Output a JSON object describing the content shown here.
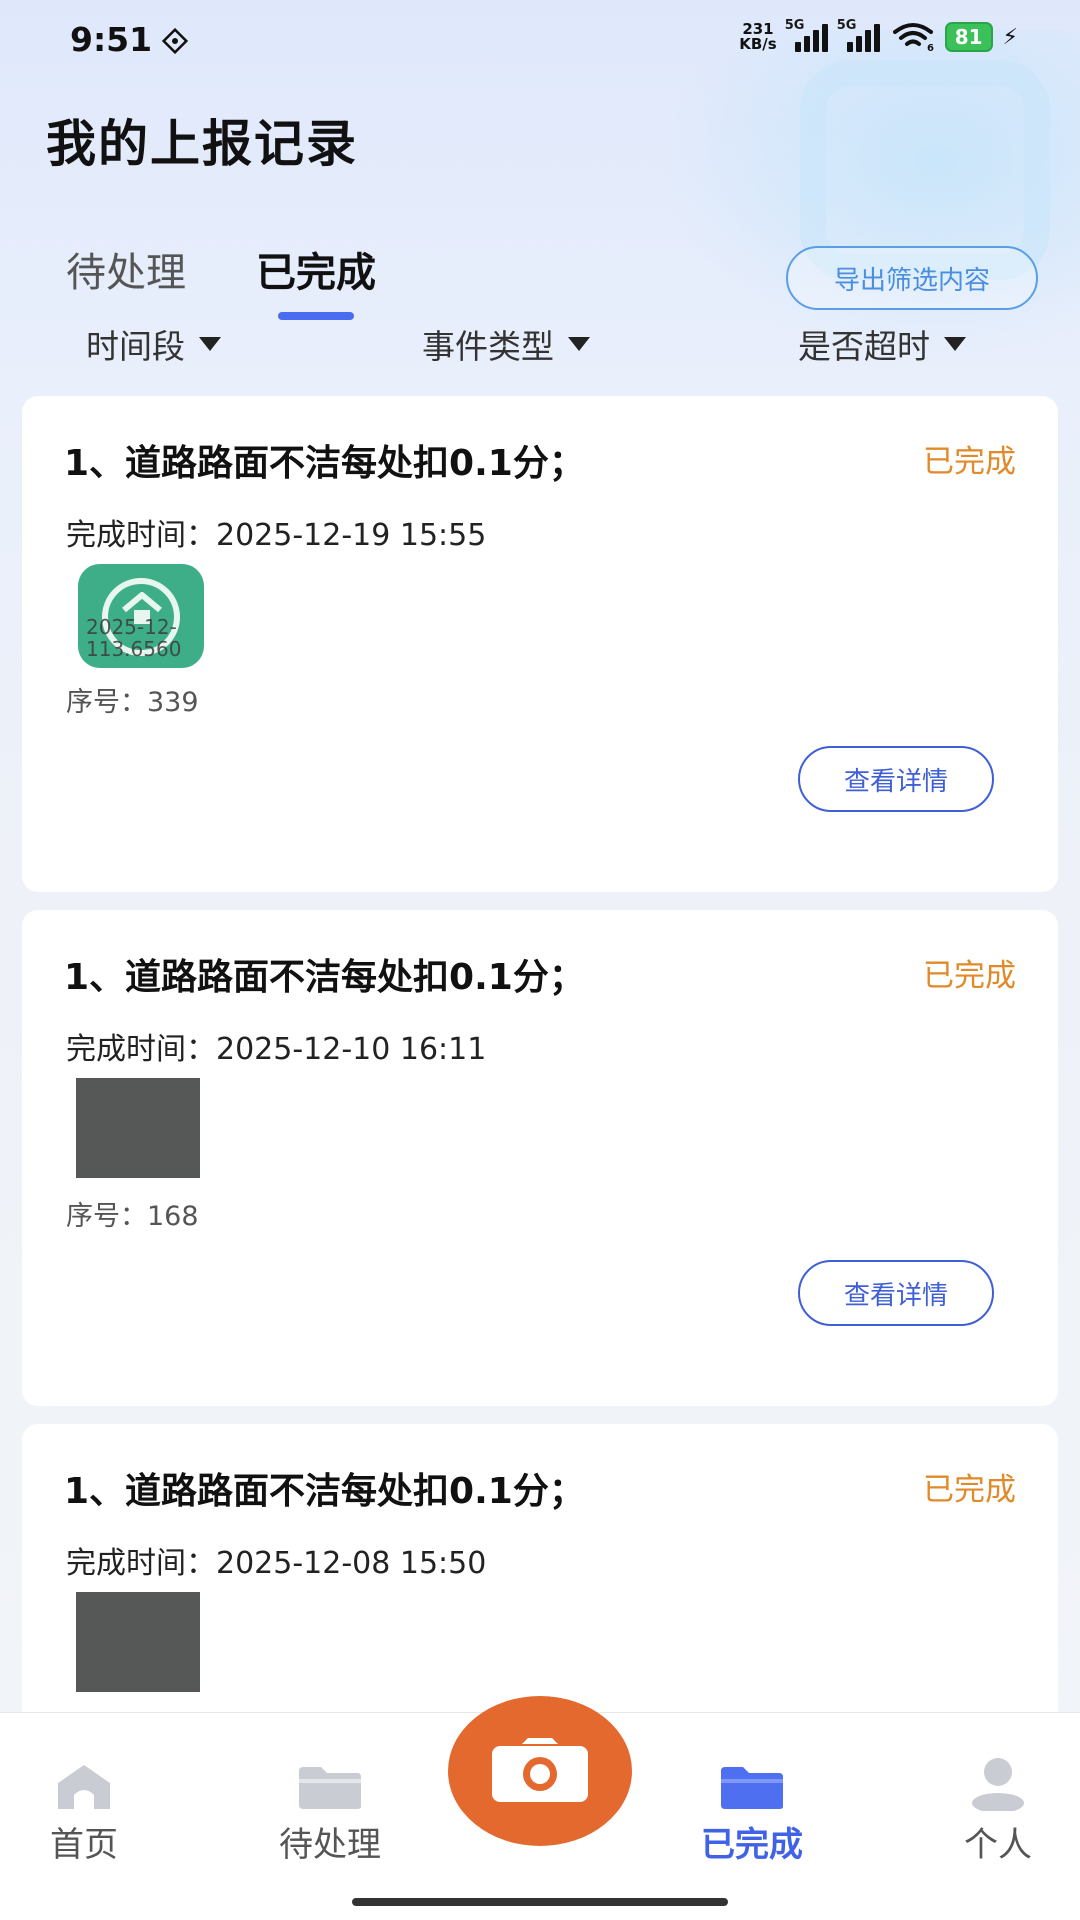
{
  "status_bar": {
    "time": "9:51",
    "net_speed_value": "231",
    "net_speed_unit": "KB/s",
    "signal1_label": "5G",
    "signal2_label": "5G",
    "wifi_badge": "6",
    "battery": "81"
  },
  "header": {
    "title": "我的上报记录"
  },
  "tabs": [
    {
      "label": "待处理",
      "active": false
    },
    {
      "label": "已完成",
      "active": true
    }
  ],
  "export_button": "导出筛选内容",
  "filters": [
    {
      "label": "时间段"
    },
    {
      "label": "事件类型"
    },
    {
      "label": "是否超时"
    }
  ],
  "records": [
    {
      "title": "1、道路路面不洁每处扣0.1分；",
      "status": "已完成",
      "time_label": "完成时间：",
      "time": "2025-12-19 15:55",
      "thumb_watermark_1": "2025-12-",
      "thumb_watermark_2": "113.6560",
      "seq_label": "序号：",
      "seq": "339",
      "detail_button": "查看详情"
    },
    {
      "title": "1、道路路面不洁每处扣0.1分；",
      "status": "已完成",
      "time_label": "完成时间：",
      "time": "2025-12-10 16:11",
      "seq_label": "序号：",
      "seq": "168",
      "detail_button": "查看详情"
    },
    {
      "title": "1、道路路面不洁每处扣0.1分；",
      "status": "已完成",
      "time_label": "完成时间：",
      "time": "2025-12-08 15:50"
    }
  ],
  "bottom_nav": [
    {
      "label": "首页",
      "icon": "home-icon",
      "active": false
    },
    {
      "label": "待处理",
      "icon": "folder-icon",
      "active": false
    },
    {
      "label": "已完成",
      "icon": "folder-icon",
      "active": true
    },
    {
      "label": "个人",
      "icon": "person-icon",
      "active": false
    }
  ],
  "colors": {
    "accent": "#3f62e6",
    "status_done": "#e08a2a",
    "camera": "#e3692f"
  }
}
